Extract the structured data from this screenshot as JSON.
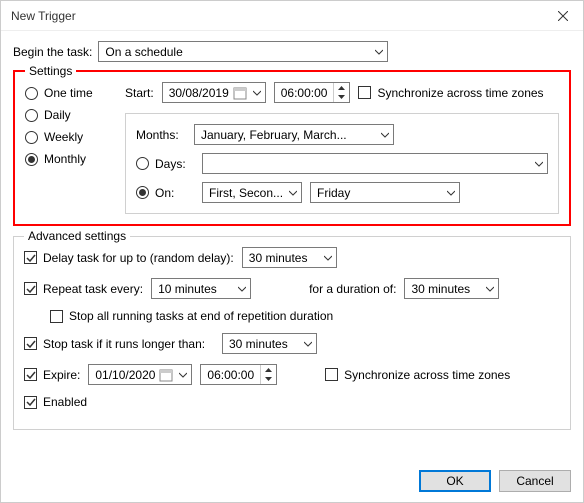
{
  "window": {
    "title": "New Trigger"
  },
  "begin": {
    "label": "Begin the task:",
    "value": "On a schedule"
  },
  "settings": {
    "legend": "Settings",
    "radios": {
      "one_time": "One time",
      "daily": "Daily",
      "weekly": "Weekly",
      "monthly": "Monthly"
    },
    "start_label": "Start:",
    "start_date": "30/08/2019",
    "start_time": "06:00:00",
    "sync_tz": "Synchronize across time zones",
    "months_label": "Months:",
    "months_value": "January, February, March...",
    "days_label": "Days:",
    "days_value": "",
    "on_label": "On:",
    "on_weeks": "First, Secon...",
    "on_day": "Friday"
  },
  "advanced": {
    "legend": "Advanced settings",
    "delay_label": "Delay task for up to (random delay):",
    "delay_value": "30 minutes",
    "repeat_label": "Repeat task every:",
    "repeat_value": "10 minutes",
    "duration_label": "for a duration of:",
    "duration_value": "30 minutes",
    "stop_all": "Stop all running tasks at end of repetition duration",
    "stop_longer_label": "Stop task if it runs longer than:",
    "stop_longer_value": "30 minutes",
    "expire_label": "Expire:",
    "expire_date": "01/10/2020",
    "expire_time": "06:00:00",
    "expire_sync": "Synchronize across time zones",
    "enabled": "Enabled"
  },
  "buttons": {
    "ok": "OK",
    "cancel": "Cancel"
  }
}
